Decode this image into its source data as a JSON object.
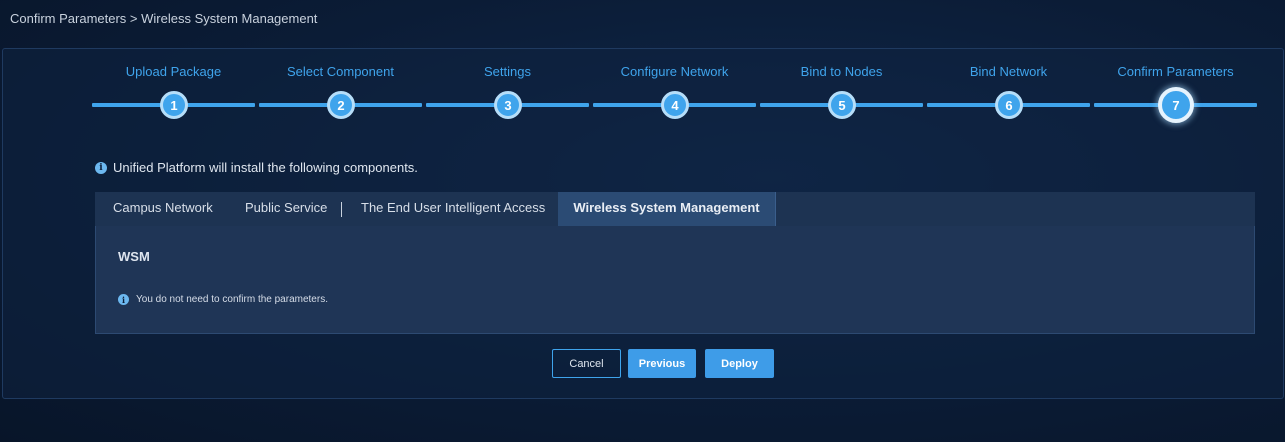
{
  "breadcrumb": "Confirm Parameters > Wireless System Management",
  "steps": [
    {
      "number": "1",
      "label": "Upload Package"
    },
    {
      "number": "2",
      "label": "Select Component"
    },
    {
      "number": "3",
      "label": "Settings"
    },
    {
      "number": "4",
      "label": "Configure Network"
    },
    {
      "number": "5",
      "label": "Bind to Nodes"
    },
    {
      "number": "6",
      "label": "Bind Network"
    },
    {
      "number": "7",
      "label": "Confirm Parameters"
    }
  ],
  "active_step": 7,
  "info_text": "Unified Platform will install the following components.",
  "tabs": [
    {
      "label": "Campus Network"
    },
    {
      "label": "Public Service"
    },
    {
      "label": "The End User Intelligent Access"
    },
    {
      "label": "Wireless System Management"
    }
  ],
  "tab_separator": "|",
  "active_tab": "Wireless System Management",
  "content": {
    "title": "WSM",
    "note": "You do not need to confirm the parameters."
  },
  "buttons": {
    "cancel": "Cancel",
    "previous": "Previous",
    "deploy": "Deploy"
  },
  "info_icon_glyph": "i",
  "colors": {
    "accent": "#3fa4ec",
    "button_primary": "#3e9ce8",
    "background": "#0b1c36"
  }
}
